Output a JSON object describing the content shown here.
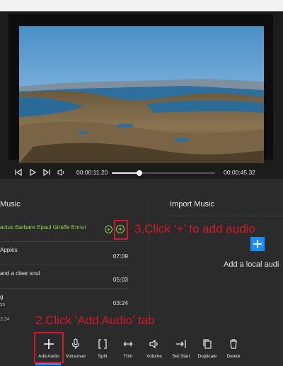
{
  "player": {
    "current_time": "00:00:11.20",
    "total_time": "00:00:45.32",
    "progress": 0.27
  },
  "music_panel": {
    "title": "Music",
    "tracks": [
      {
        "name": "actus Barbare Epaul Giraffe Ennui",
        "duration": "",
        "sub": ""
      },
      {
        "name": "Apples",
        "duration": "07:09",
        "sub": ""
      },
      {
        "name": "and a clear soul",
        "duration": "05:03",
        "sub": ""
      },
      {
        "name": "g",
        "duration": "03:24",
        "sub": "ss"
      }
    ],
    "scroll_marker": "3:34"
  },
  "import_panel": {
    "title": "Import Music",
    "add_text": "Add a local audi"
  },
  "annotations": {
    "step3": "3.Click ‘+’ to add audio",
    "step2": "2.Click ‘Add Audio’ tab"
  },
  "toolbar": {
    "tools": [
      {
        "label": "Add Audio",
        "icon": "plus-icon"
      },
      {
        "label": "Voiceover",
        "icon": "microphone-icon"
      },
      {
        "label": "Split",
        "icon": "split-icon"
      },
      {
        "label": "Trim",
        "icon": "trim-icon"
      },
      {
        "label": "Volume",
        "icon": "volume-icon"
      },
      {
        "label": "Set Start",
        "icon": "set-start-icon"
      },
      {
        "label": "Duplicate",
        "icon": "duplicate-icon"
      },
      {
        "label": "Delete",
        "icon": "trash-icon"
      }
    ]
  },
  "colors": {
    "accent_green": "#8fd14f",
    "accent_blue": "#1a8cff",
    "annotation_red": "#d0192b"
  }
}
